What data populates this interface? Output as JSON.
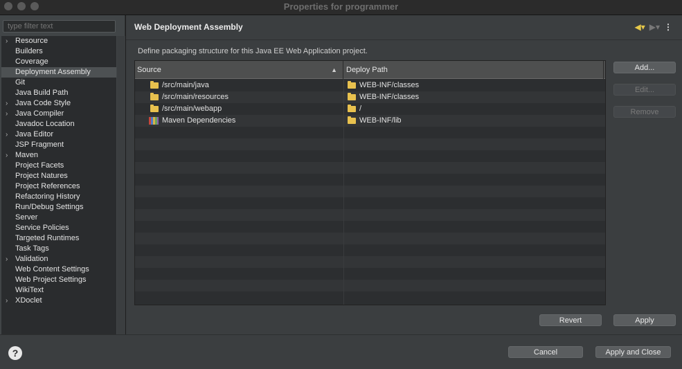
{
  "window": {
    "title": "Properties for programmer"
  },
  "sidebar": {
    "filter_placeholder": "type filter text",
    "items": [
      {
        "label": "Resource",
        "expandable": true
      },
      {
        "label": "Builders",
        "expandable": false
      },
      {
        "label": "Coverage",
        "expandable": false
      },
      {
        "label": "Deployment Assembly",
        "expandable": false,
        "selected": true
      },
      {
        "label": "Git",
        "expandable": false
      },
      {
        "label": "Java Build Path",
        "expandable": false
      },
      {
        "label": "Java Code Style",
        "expandable": true
      },
      {
        "label": "Java Compiler",
        "expandable": true
      },
      {
        "label": "Javadoc Location",
        "expandable": false
      },
      {
        "label": "Java Editor",
        "expandable": true
      },
      {
        "label": "JSP Fragment",
        "expandable": false
      },
      {
        "label": "Maven",
        "expandable": true
      },
      {
        "label": "Project Facets",
        "expandable": false
      },
      {
        "label": "Project Natures",
        "expandable": false
      },
      {
        "label": "Project References",
        "expandable": false
      },
      {
        "label": "Refactoring History",
        "expandable": false
      },
      {
        "label": "Run/Debug Settings",
        "expandable": false
      },
      {
        "label": "Server",
        "expandable": false
      },
      {
        "label": "Service Policies",
        "expandable": false
      },
      {
        "label": "Targeted Runtimes",
        "expandable": false
      },
      {
        "label": "Task Tags",
        "expandable": false
      },
      {
        "label": "Validation",
        "expandable": true
      },
      {
        "label": "Web Content Settings",
        "expandable": false
      },
      {
        "label": "Web Project Settings",
        "expandable": false
      },
      {
        "label": "WikiText",
        "expandable": false
      },
      {
        "label": "XDoclet",
        "expandable": true
      }
    ]
  },
  "page": {
    "title": "Web Deployment Assembly",
    "description": "Define packaging structure for this Java EE Web Application project.",
    "columns": {
      "source": "Source",
      "deploy_path": "Deploy Path"
    },
    "rows": [
      {
        "source": "/src/main/java",
        "source_icon": "folder-icon",
        "deploy": "WEB-INF/classes"
      },
      {
        "source": "/src/main/resources",
        "source_icon": "folder-icon",
        "deploy": "WEB-INF/classes"
      },
      {
        "source": "/src/main/webapp",
        "source_icon": "folder-icon",
        "deploy": "/"
      },
      {
        "source": "Maven Dependencies",
        "source_icon": "library-icon",
        "deploy": "WEB-INF/lib"
      }
    ],
    "buttons": {
      "add": "Add...",
      "edit": "Edit...",
      "remove": "Remove",
      "revert": "Revert",
      "apply": "Apply"
    }
  },
  "footer": {
    "cancel": "Cancel",
    "apply_close": "Apply and Close"
  },
  "colors": {
    "folder": "#e8c14e",
    "back_arrow": "#e6c84a"
  }
}
